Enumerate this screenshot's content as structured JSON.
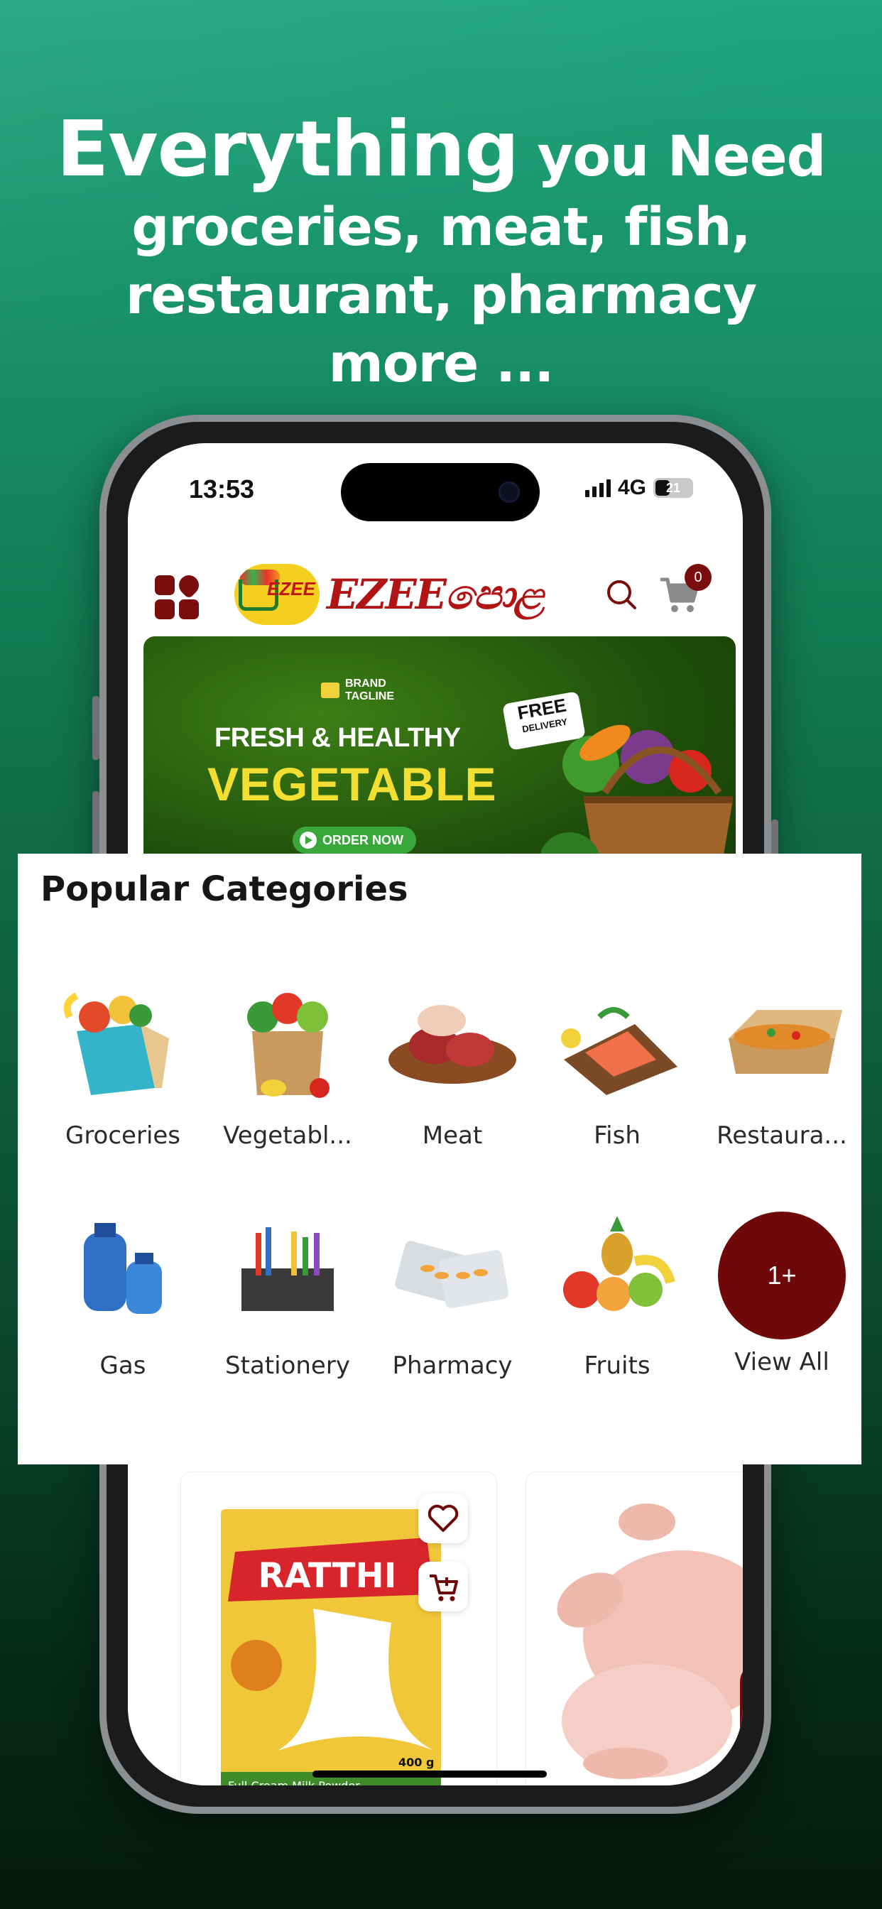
{
  "headline": {
    "line1_big": "Everything",
    "line1_rest": " you Need",
    "line2": "groceries, meat, fish,",
    "line3": "restaurant, pharmacy",
    "line4": "more ..."
  },
  "status_bar": {
    "time": "13:53",
    "network": "4G",
    "battery": "21"
  },
  "app_header": {
    "logo_badge_text": "EZEE",
    "logo_text": "EZEEපොළ",
    "cart_count": "0"
  },
  "banner": {
    "brand": "BRAND",
    "tagline": "TAGLINE",
    "title_top": "FRESH & HEALTHY",
    "title_main": "VEGETABLE",
    "badge_top": "FREE",
    "badge_bottom": "DELIVERY",
    "cta": "ORDER NOW"
  },
  "popular_categories": {
    "title": "Popular Categories",
    "items": [
      {
        "label": "Groceries",
        "icon": "groceries-bag"
      },
      {
        "label": "Vegetabl...",
        "icon": "vegetables-bag"
      },
      {
        "label": "Meat",
        "icon": "meat-board"
      },
      {
        "label": "Fish",
        "icon": "fish-board"
      },
      {
        "label": "Restaura...",
        "icon": "food-box"
      },
      {
        "label": "Gas",
        "icon": "gas-cylinder"
      },
      {
        "label": "Stationery",
        "icon": "stationery-organizer"
      },
      {
        "label": "Pharmacy",
        "icon": "pill-packs"
      },
      {
        "label": "Fruits",
        "icon": "fruit-basket"
      },
      {
        "label": "View All",
        "icon": "view-all-circle",
        "badge": "1+"
      }
    ]
  },
  "products": {
    "card1": {
      "brand": "RATTHI",
      "caption": "Full Cream Milk Powder",
      "weight": "400 g"
    }
  },
  "colors": {
    "accent": "#6f0808",
    "logo_red": "#b01414",
    "banner_yellow": "#f3df31"
  }
}
